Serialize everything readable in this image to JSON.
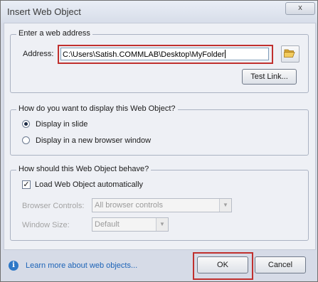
{
  "dialog": {
    "title": "Insert Web Object",
    "close_glyph": "x"
  },
  "address_group": {
    "legend": "Enter a web address",
    "address_label": "Address:",
    "address_value": "C:\\Users\\Satish.COMMLAB\\Desktop\\MyFolder",
    "folder_icon": "folder-open-icon",
    "test_link_label": "Test Link..."
  },
  "display_group": {
    "legend": "How do you want to display this Web Object?",
    "options": [
      {
        "label": "Display in slide",
        "selected": true
      },
      {
        "label": "Display in a new browser window",
        "selected": false
      }
    ]
  },
  "behave_group": {
    "legend": "How should this Web Object behave?",
    "load_auto_label": "Load Web Object automatically",
    "load_auto_checked": true,
    "browser_controls_label": "Browser Controls:",
    "browser_controls_value": "All browser controls",
    "window_size_label": "Window Size:",
    "window_size_value": "Default"
  },
  "footer": {
    "info_icon": "info-icon",
    "help_link": "Learn more about web objects...",
    "ok_label": "OK",
    "cancel_label": "Cancel"
  },
  "colors": {
    "highlight_border": "#c0302e",
    "link": "#1c63b7",
    "dialog_background": "#d6dbe7"
  }
}
